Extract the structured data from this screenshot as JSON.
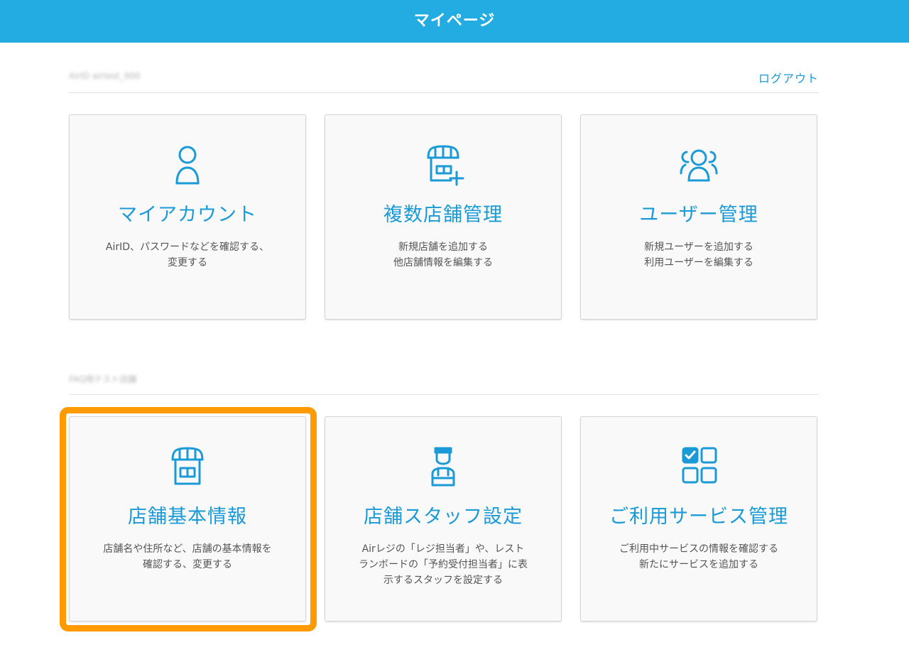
{
  "header": {
    "title": "マイページ"
  },
  "account_section": {
    "label": "AirID airtest_000",
    "logout_label": "ログアウト"
  },
  "store_section": {
    "label": "FAQ用テスト店舗"
  },
  "cards": [
    {
      "title": "マイアカウント",
      "desc": [
        "AirID、パスワードなどを確認する、",
        "変更する"
      ],
      "icon": "user-icon"
    },
    {
      "title": "複数店舗管理",
      "desc": [
        "新規店舗を追加する",
        "他店舗情報を編集する"
      ],
      "icon": "store-add-icon"
    },
    {
      "title": "ユーザー管理",
      "desc": [
        "新規ユーザーを追加する",
        "利用ユーザーを編集する"
      ],
      "icon": "users-icon"
    },
    {
      "title": "店舗基本情報",
      "desc": [
        "店舗名や住所など、店舗の基本情報を",
        "確認する、変更する"
      ],
      "icon": "store-icon"
    },
    {
      "title": "店舗スタッフ設定",
      "desc": [
        "Airレジの「レジ担当者」や、レスト",
        "ランボードの「予約受付担当者」に表",
        "示するスタッフを設定する"
      ],
      "icon": "staff-icon"
    },
    {
      "title": "ご利用サービス管理",
      "desc": [
        "ご利用中サービスの情報を確認する",
        "新たにサービスを追加する"
      ],
      "icon": "services-grid-icon"
    }
  ],
  "colors": {
    "header_bg": "#22ace2",
    "accent": "#1a9ad6",
    "highlight": "#ff9a00"
  }
}
